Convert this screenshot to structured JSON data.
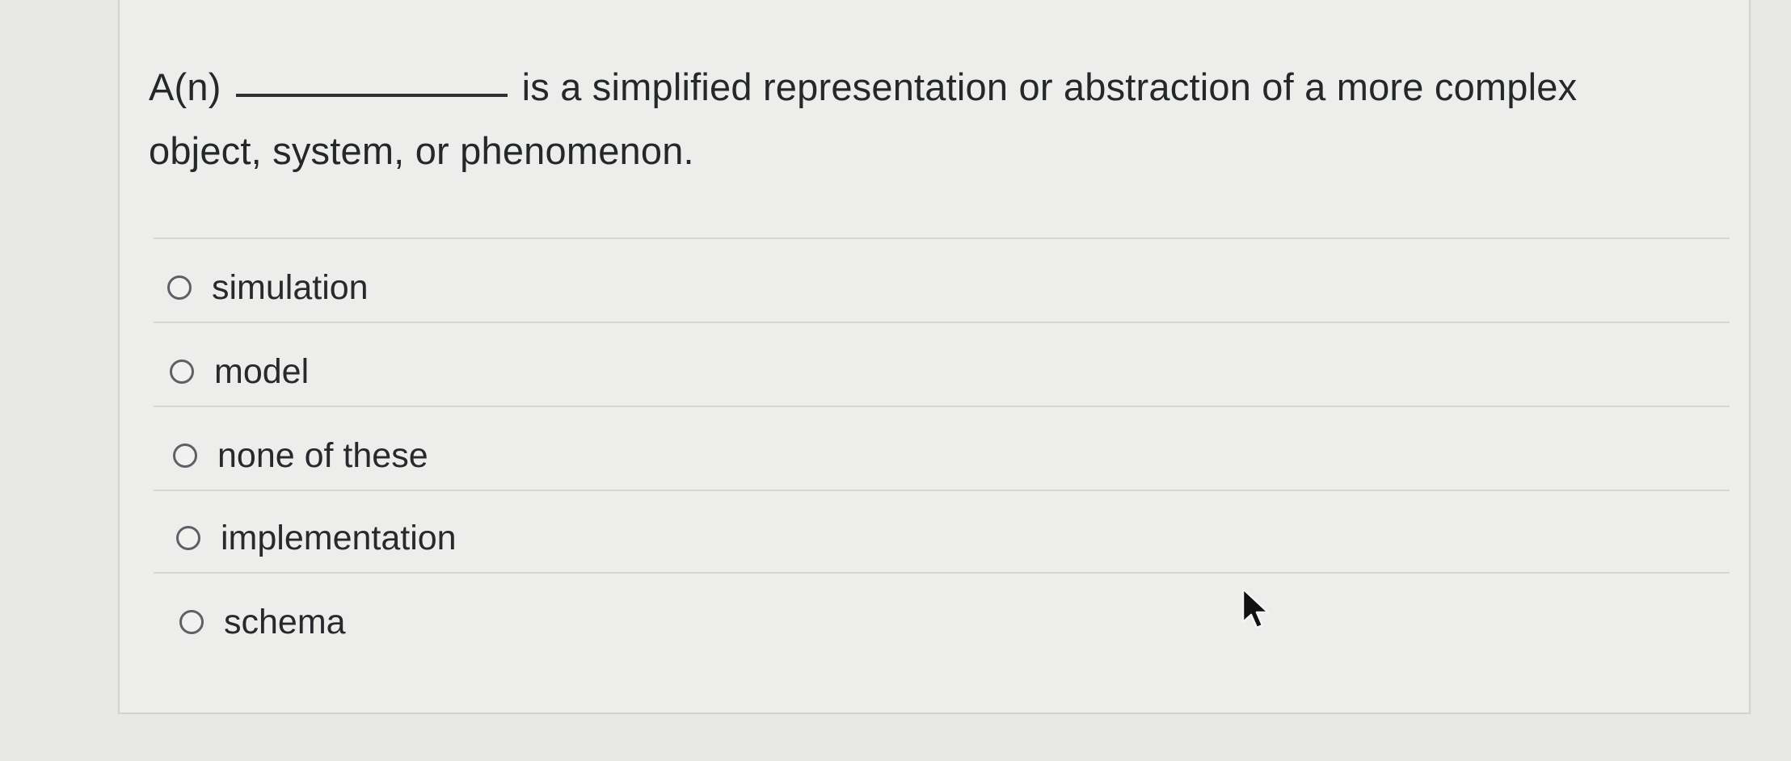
{
  "question": {
    "prefix": "A(n)",
    "suffix": "is a simplified representation or abstraction of a more complex object, system, or phenomenon."
  },
  "options": [
    {
      "label": "simulation",
      "selected": false
    },
    {
      "label": "model",
      "selected": false
    },
    {
      "label": "none of these",
      "selected": false
    },
    {
      "label": "implementation",
      "selected": false
    },
    {
      "label": "schema",
      "selected": false
    }
  ],
  "icons": {
    "cursor": "arrow-pointer-icon",
    "radio": "radio-unselected-icon"
  },
  "colors": {
    "background": "#e7e8e5",
    "card": "#edeeec",
    "text": "#25282b",
    "radio_border": "#5d6166"
  }
}
